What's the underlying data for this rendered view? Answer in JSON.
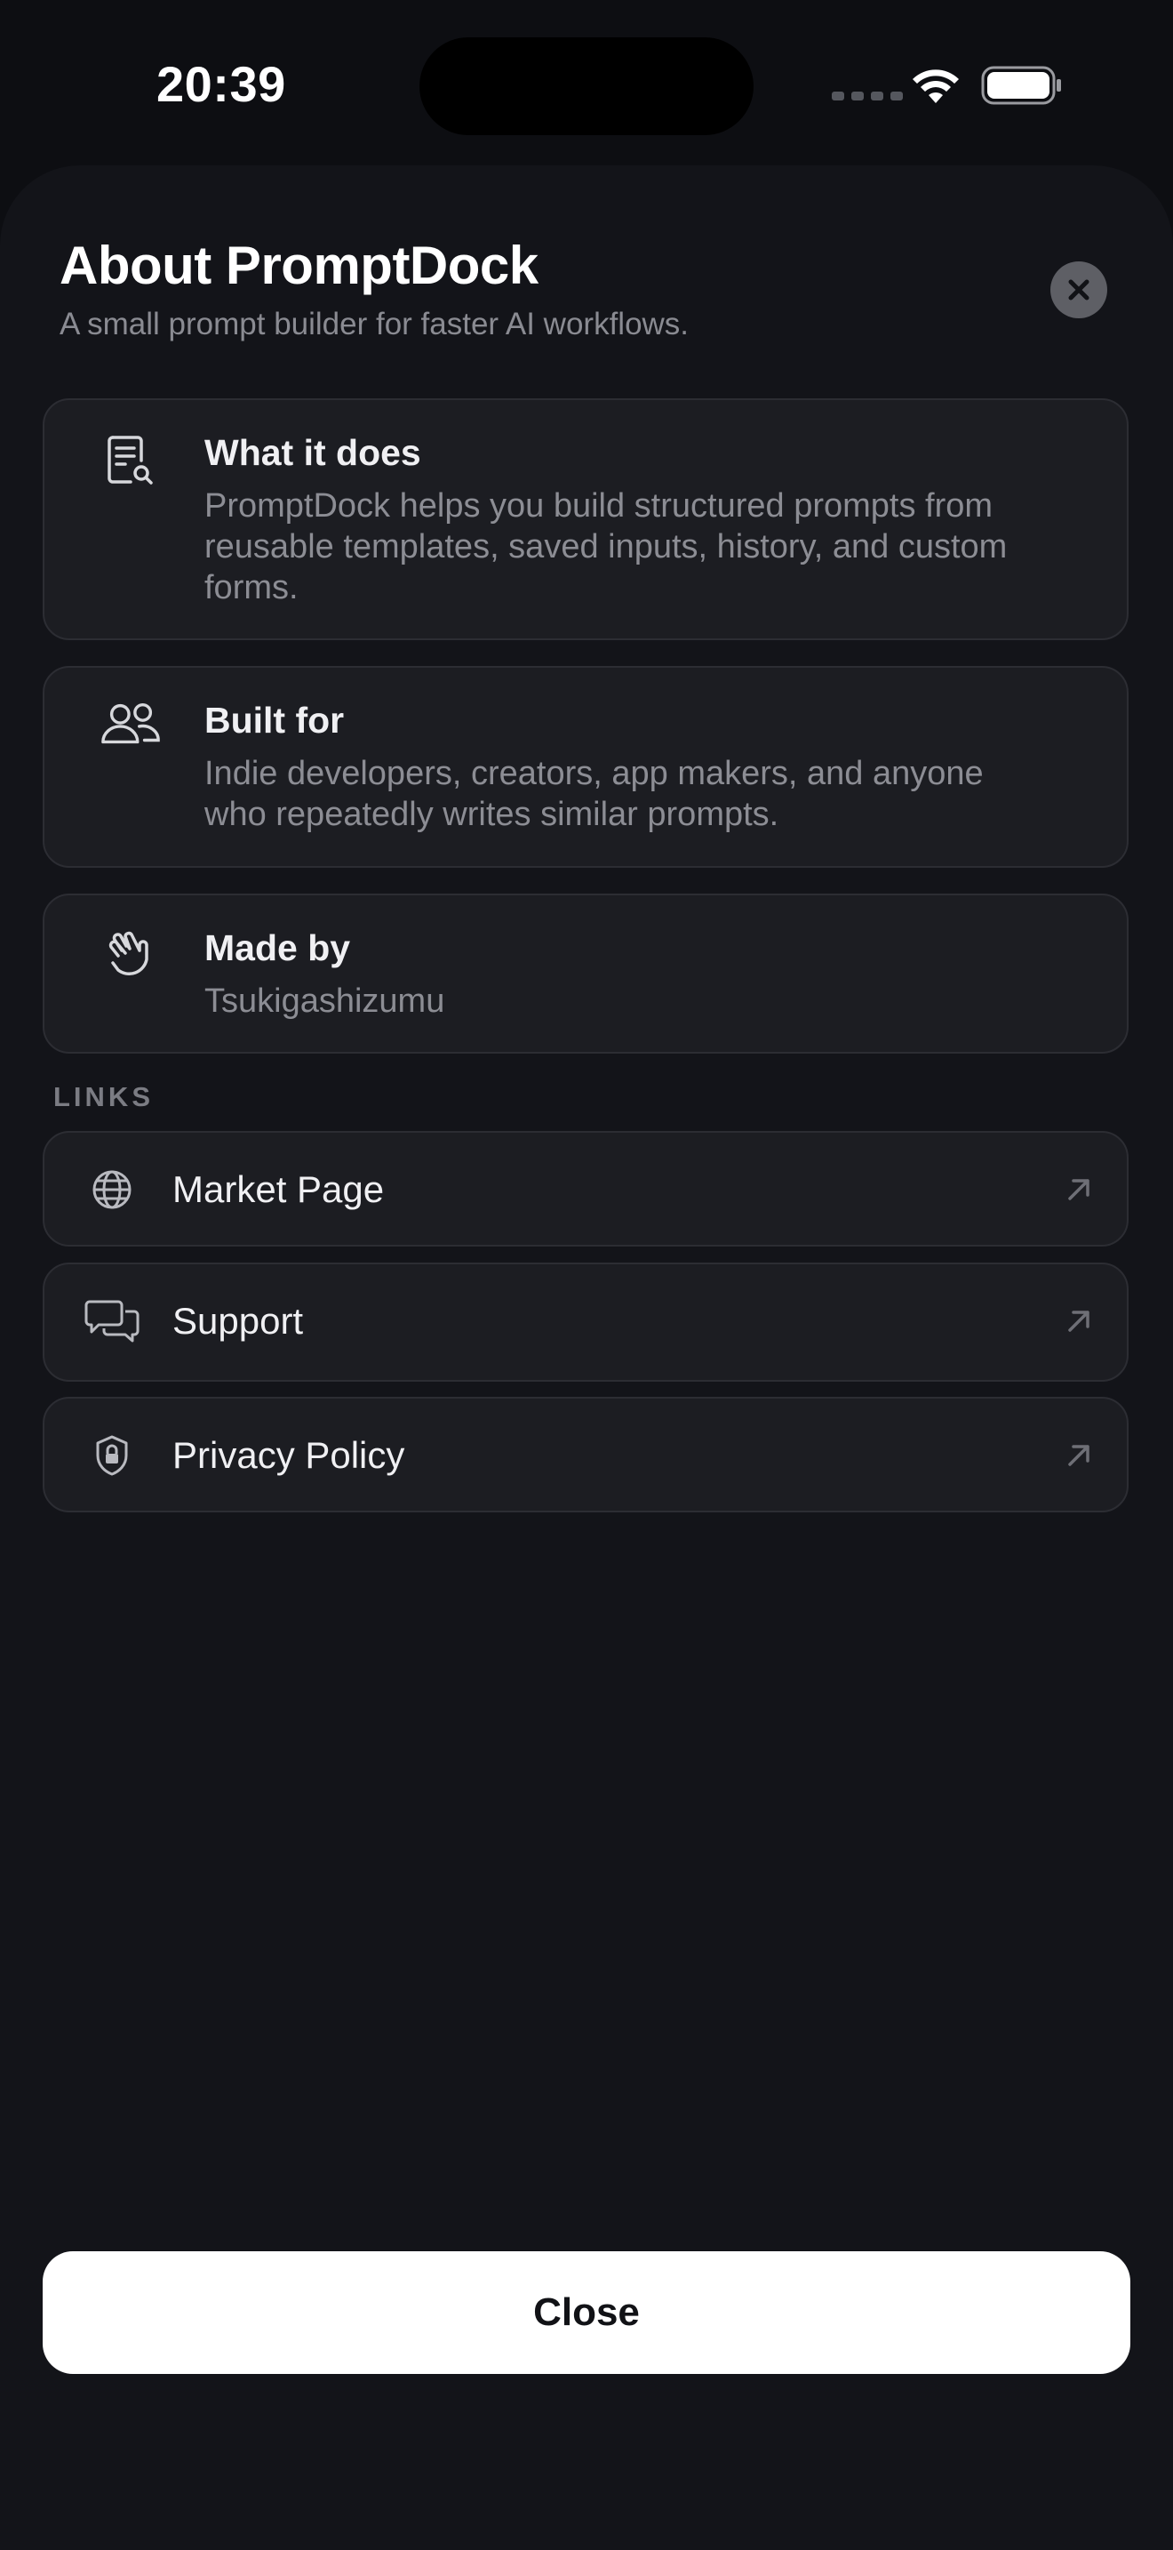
{
  "status_bar": {
    "time": "20:39"
  },
  "header": {
    "title": "About PromptDock",
    "subtitle": "A small prompt builder for faster AI workflows.",
    "dismiss_icon": "xmark-circle-icon"
  },
  "cards": [
    {
      "icon": "document-search-icon",
      "title": "What it does",
      "body": "PromptDock helps you build structured prompts from reusable templates, saved inputs, history, and custom forms."
    },
    {
      "icon": "people-icon",
      "title": "Built for",
      "body": "Indie developers, creators, app makers, and anyone who repeatedly writes similar prompts."
    },
    {
      "icon": "hand-wave-icon",
      "title": "Made by",
      "body": "Tsukigashizumu"
    }
  ],
  "links": {
    "section_label": "LINKS",
    "items": [
      {
        "icon": "globe-icon",
        "label": "Market Page",
        "trailing_icon": "arrow-up-right-icon"
      },
      {
        "icon": "speech-bubbles-icon",
        "label": "Support",
        "trailing_icon": "arrow-up-right-icon"
      },
      {
        "icon": "shield-lock-icon",
        "label": "Privacy Policy",
        "trailing_icon": "arrow-up-right-icon"
      }
    ]
  },
  "footer": {
    "close_label": "Close"
  },
  "colors": {
    "background": "#0d0e12",
    "sheet": "#131419",
    "card": "#1c1d22",
    "card_border": "#2c2d33",
    "primary_text": "#f0f0f3",
    "secondary_text": "#8c8d94",
    "close_button_bg": "#ffffff"
  }
}
